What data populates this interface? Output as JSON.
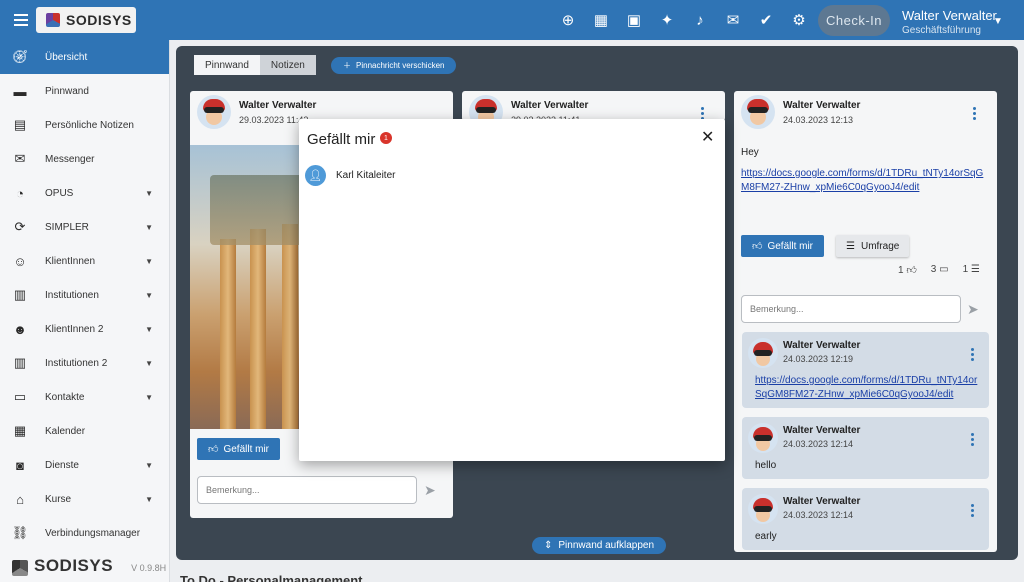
{
  "header": {
    "brand": "SODISYS",
    "checkin_label": "Check-In",
    "user_name": "Walter Verwalter",
    "user_role": "Geschäftsführung",
    "icons": [
      "add-circle-icon",
      "board-icon",
      "calendar-icon",
      "lamp-icon",
      "bell-icon",
      "mail-icon",
      "check-circle-icon",
      "gear-icon"
    ]
  },
  "sidebar": {
    "items": [
      {
        "label": "Übersicht",
        "icon": "compass-icon",
        "expandable": false,
        "active": true
      },
      {
        "label": "Pinnwand",
        "icon": "chat-icon",
        "expandable": false
      },
      {
        "label": "Persönliche Notizen",
        "icon": "note-icon",
        "expandable": false
      },
      {
        "label": "Messenger",
        "icon": "mail-icon",
        "expandable": false
      },
      {
        "label": "OPUS",
        "icon": "pie-icon",
        "expandable": true
      },
      {
        "label": "SIMPLER",
        "icon": "sync-icon",
        "expandable": true
      },
      {
        "label": "KlientInnen",
        "icon": "smiley-icon",
        "expandable": true
      },
      {
        "label": "Institutionen",
        "icon": "building-icon",
        "expandable": true
      },
      {
        "label": "KlientInnen 2",
        "icon": "smiley-filled-icon",
        "expandable": true
      },
      {
        "label": "Institutionen 2",
        "icon": "building-icon",
        "expandable": true
      },
      {
        "label": "Kontakte",
        "icon": "contact-card-icon",
        "expandable": true
      },
      {
        "label": "Kalender",
        "icon": "calendar-icon",
        "expandable": false
      },
      {
        "label": "Dienste",
        "icon": "badge-icon",
        "expandable": true
      },
      {
        "label": "Kurse",
        "icon": "graduation-icon",
        "expandable": true
      },
      {
        "label": "Verbindungsmanager",
        "icon": "link-icon",
        "expandable": false
      }
    ],
    "footer_brand": "SODISYS",
    "version": "V 0.9.8H"
  },
  "board": {
    "tabs": [
      "Pinnwand",
      "Notizen"
    ],
    "send_label": "Pinnachricht verschicken",
    "expand_label": "Pinnwand aufklappen",
    "post1": {
      "author": "Walter Verwalter",
      "date": "29.03.2023 11:42",
      "like_label": "Gefällt mir",
      "comment_placeholder": "Bemerkung..."
    },
    "post2": {
      "author": "Walter Verwalter",
      "date": "29.03.2023 11:41"
    },
    "post3": {
      "author": "Walter Verwalter",
      "date": "24.03.2023 12:13",
      "text": "Hey",
      "link": "https://docs.google.com/forms/d/1TDRu_tNTy14orSqGM8FM27-ZHnw_xpMie6C0qGyooJ4/edit",
      "like_label": "Gefällt mir",
      "survey_label": "Umfrage",
      "likes": "1",
      "comments": "3",
      "votes": "1",
      "comment_placeholder": "Bemerkung..."
    },
    "comments": [
      {
        "author": "Walter Verwalter",
        "date": "24.03.2023 12:19",
        "text": "https://docs.google.com/forms/d/1TDRu_tNTy14orSqGM8FM27-ZHnw_xpMie6C0qGyooJ4/edit"
      },
      {
        "author": "Walter Verwalter",
        "date": "24.03.2023 12:14",
        "text": "hello"
      },
      {
        "author": "Walter Verwalter",
        "date": "24.03.2023 12:14",
        "text": "early"
      }
    ]
  },
  "bottom_heading": "To Do - Personalmanagement",
  "modal": {
    "title": "Gefällt mir",
    "count": "1",
    "likers": [
      {
        "name": "Karl Kitaleiter"
      }
    ]
  },
  "colors": {
    "primary": "#2f74b5",
    "panel": "#3b4651",
    "badge": "#d9352b"
  }
}
